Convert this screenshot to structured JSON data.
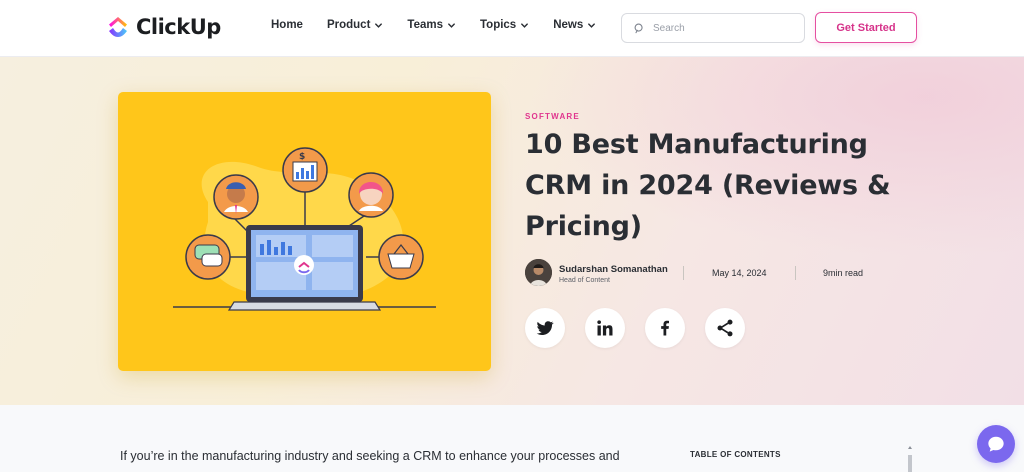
{
  "brand": {
    "name": "ClickUp"
  },
  "nav": {
    "items": [
      {
        "label": "Home",
        "dropdown": false
      },
      {
        "label": "Product",
        "dropdown": true
      },
      {
        "label": "Teams",
        "dropdown": true
      },
      {
        "label": "Topics",
        "dropdown": true
      },
      {
        "label": "News",
        "dropdown": true
      }
    ],
    "search_placeholder": "Search",
    "cta_label": "Get Started"
  },
  "article": {
    "category": "SOFTWARE",
    "title": "10 Best Manufacturing CRM in 2024 (Reviews & Pricing)",
    "author": {
      "name": "Sudarshan Somanathan",
      "role": "Head of Content"
    },
    "date": "May 14, 2024",
    "read_time": "9min read",
    "share": [
      "twitter-icon",
      "linkedin-icon",
      "facebook-icon",
      "share-icon"
    ],
    "intro": "If you’re in the manufacturing industry and seeking a CRM to enhance your processes and"
  },
  "sidebar": {
    "toc_label": "TABLE OF CONTENTS"
  },
  "colors": {
    "accent_pink": "#e0358e",
    "hero_yellow": "#ffc61a",
    "chat_purple": "#7b68ee"
  }
}
